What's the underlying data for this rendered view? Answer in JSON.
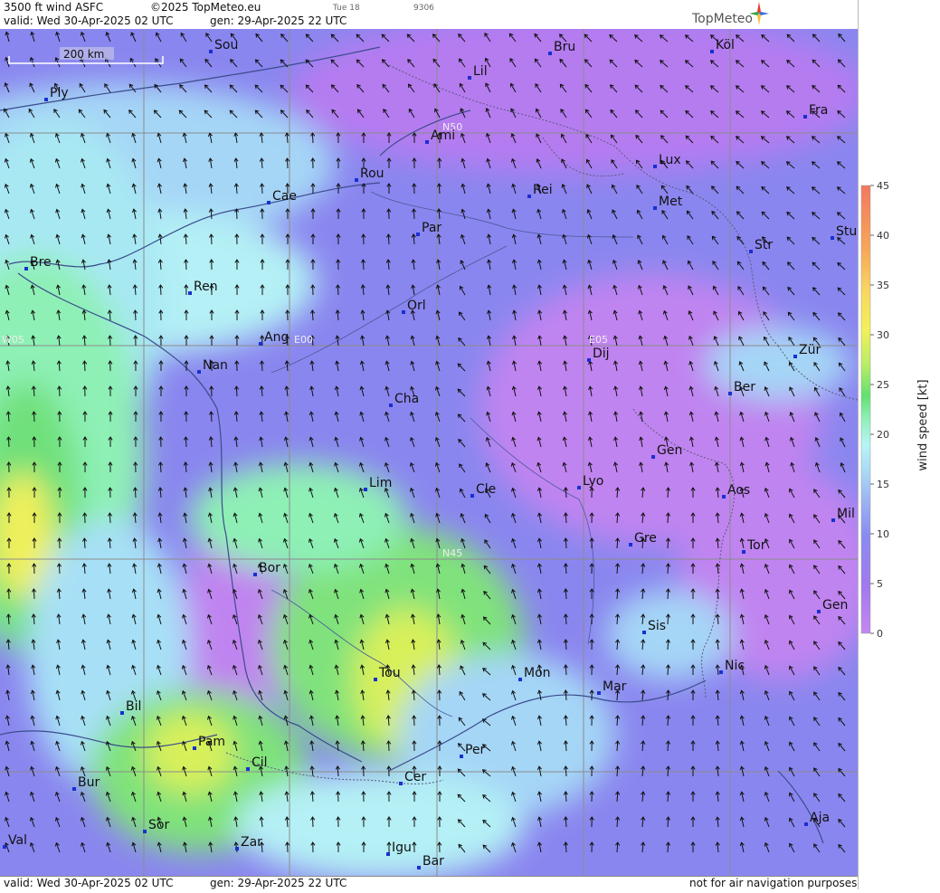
{
  "header": {
    "product": "3500 ft wind ASFC",
    "copyright": "©2025 TopMeteo.eu",
    "tab_day": "Tue 18",
    "tab_code": "9306",
    "valid": "valid:  Wed  30-Apr-2025  02 UTC",
    "gen": "gen:  29-Apr-2025  22 UTC",
    "brand": "TopMeteo"
  },
  "footer": {
    "valid": "valid:  Wed  30-Apr-2025  02 UTC",
    "gen": "gen:  29-Apr-2025  22 UTC",
    "disclaimer": "not for air navigation purposes"
  },
  "map": {
    "scale_label": "200 km",
    "grid_labels": [
      "N50",
      "N45",
      "W05",
      "E00",
      "E05"
    ],
    "cities": [
      "Sou",
      "Bru",
      "Köl",
      "Lil",
      "Ply",
      "Ami",
      "Fra",
      "Lux",
      "Rou",
      "Rei",
      "Cae",
      "Met",
      "Par",
      "Stu",
      "Str",
      "Bre",
      "Ren",
      "Orl",
      "Ang",
      "Dij",
      "Zür",
      "Nan",
      "Ber",
      "Cha",
      "Gen",
      "Lim",
      "Cle",
      "Lyo",
      "Aos",
      "Mil",
      "Gre",
      "Tor",
      "Bor",
      "Gen",
      "Sis",
      "Tou",
      "Mon",
      "Nic",
      "Mar",
      "Bil",
      "Pam",
      "Per",
      "Cil",
      "Cer",
      "Bur",
      "Sor",
      "Aja",
      "Val",
      "Zar",
      "Igu",
      "Bar"
    ]
  },
  "legend": {
    "title": "wind speed [kt]",
    "ticks": [
      "45",
      "40",
      "35",
      "30",
      "25",
      "20",
      "15",
      "10",
      "5",
      "0"
    ],
    "colors": [
      "#c586f0",
      "#a079ed",
      "#8a8cf0",
      "#9db6f2",
      "#a9d8f7",
      "#b8f4f5",
      "#8ff0b8",
      "#62e070",
      "#b8ee66",
      "#f4f05a",
      "#f8d860",
      "#f7a65a",
      "#f27860"
    ]
  }
}
